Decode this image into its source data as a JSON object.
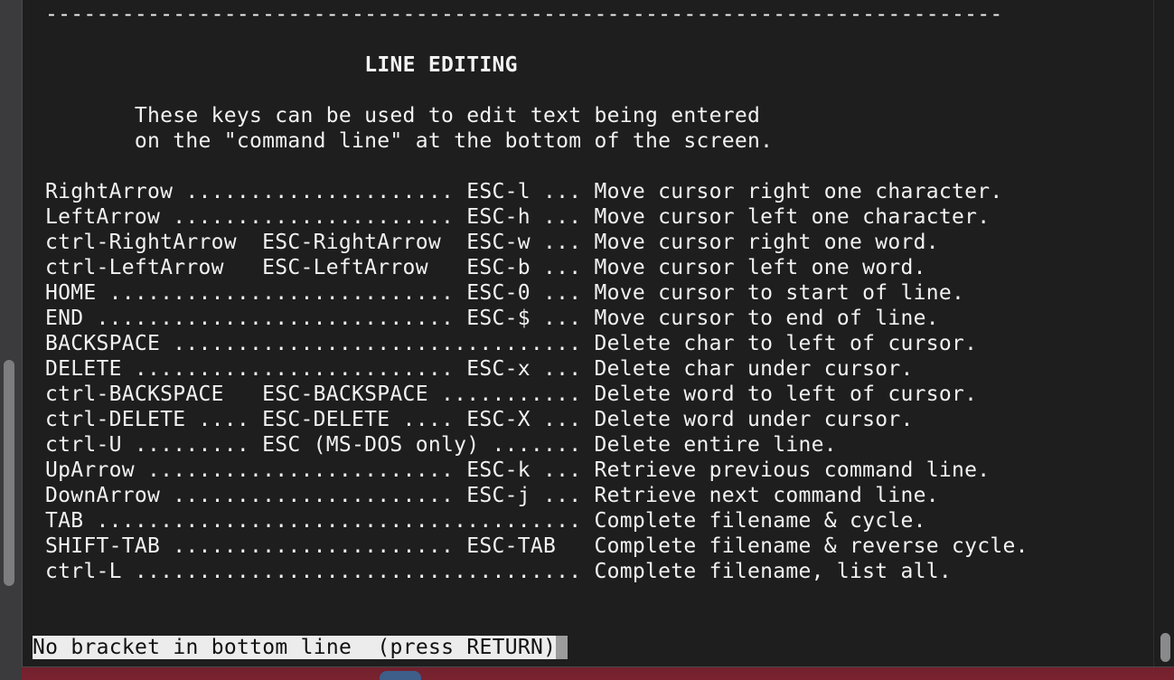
{
  "terminal": {
    "separator": "---------------------------------------------------------------------------",
    "section_title": "LINE EDITING",
    "intro": [
      "These keys can be used to edit text being entered",
      "on the \"command line\" at the bottom of the screen."
    ],
    "bindings": [
      "RightArrow ..................... ESC-l ... Move cursor right one character.",
      "LeftArrow ...................... ESC-h ... Move cursor left one character.",
      "ctrl-RightArrow  ESC-RightArrow  ESC-w ... Move cursor right one word.",
      "ctrl-LeftArrow   ESC-LeftArrow   ESC-b ... Move cursor left one word.",
      "HOME ........................... ESC-0 ... Move cursor to start of line.",
      "END ............................ ESC-$ ... Move cursor to end of line.",
      "BACKSPACE ................................ Delete char to left of cursor.",
      "DELETE ......................... ESC-x ... Delete char under cursor.",
      "ctrl-BACKSPACE   ESC-BACKSPACE ........... Delete word to left of cursor.",
      "ctrl-DELETE .... ESC-DELETE .... ESC-X ... Delete word under cursor.",
      "ctrl-U ......... ESC (MS-DOS only) ....... Delete entire line.",
      "UpArrow ........................ ESC-k ... Retrieve previous command line.",
      "DownArrow ...................... ESC-j ... Retrieve next command line.",
      "TAB ...................................... Complete filename & cycle.",
      "SHIFT-TAB ...................... ESC-TAB   Complete filename & reverse cycle.",
      "ctrl-L ................................... Complete filename, list all."
    ],
    "status_prompt": "No bracket in bottom line  (press RETURN)"
  },
  "colors": {
    "background": "#1e1e1e",
    "foreground": "#f2f2f2",
    "status_background": "#ececec",
    "status_foreground": "#111111",
    "cursor": "#9c9c9c"
  }
}
